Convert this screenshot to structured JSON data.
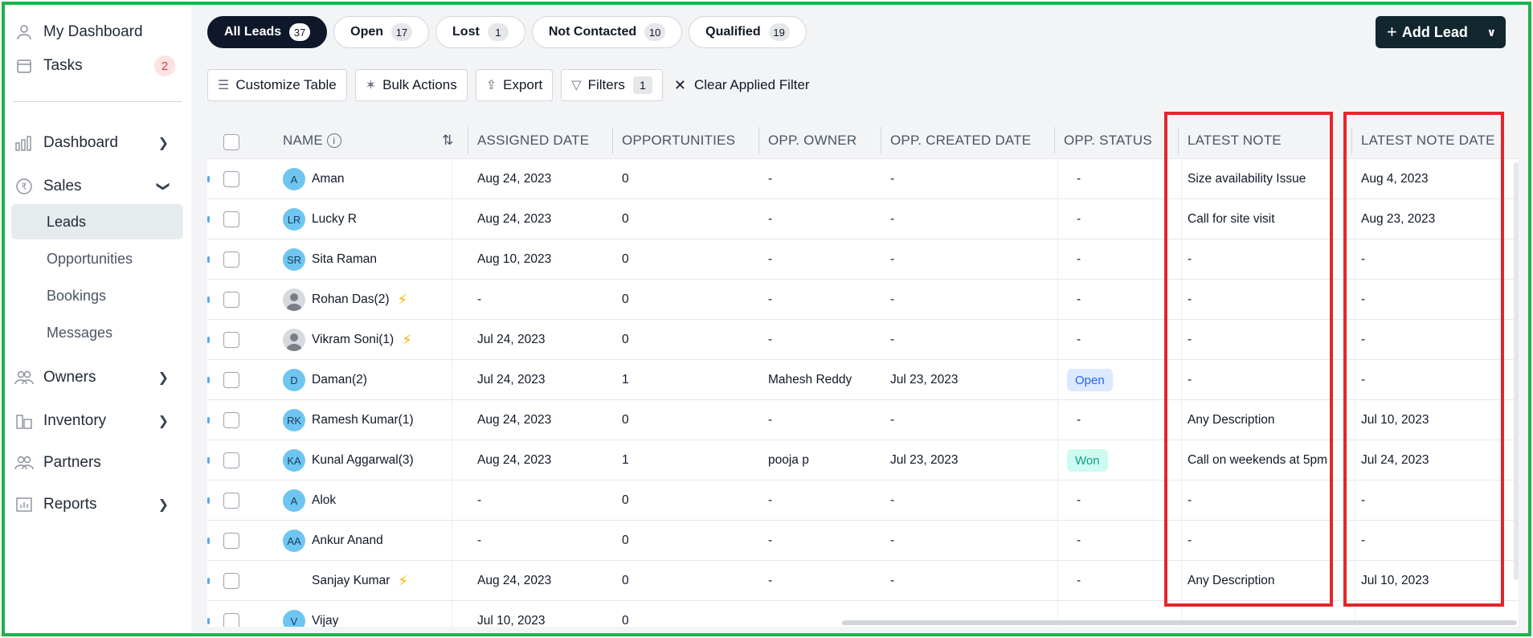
{
  "sidebar": {
    "items": [
      {
        "label": "My Dashboard",
        "icon": "user-icon"
      },
      {
        "label": "Tasks",
        "icon": "calendar-icon",
        "badge": "2"
      },
      {
        "label": "Dashboard",
        "icon": "bar-chart-icon"
      },
      {
        "label": "Sales",
        "icon": "rupee-icon"
      },
      {
        "label": "Owners",
        "icon": "users-icon"
      },
      {
        "label": "Inventory",
        "icon": "building-icon"
      },
      {
        "label": "Partners",
        "icon": "partners-icon"
      },
      {
        "label": "Reports",
        "icon": "report-icon"
      }
    ],
    "sales_sub": [
      "Leads",
      "Opportunities",
      "Bookings",
      "Messages"
    ]
  },
  "tabs": [
    {
      "label": "All Leads",
      "count": "37"
    },
    {
      "label": "Open",
      "count": "17"
    },
    {
      "label": "Lost",
      "count": "1"
    },
    {
      "label": "Not Contacted",
      "count": "10"
    },
    {
      "label": "Qualified",
      "count": "19"
    }
  ],
  "add_lead_label": "Add Lead",
  "toolbar": {
    "customize": "Customize Table",
    "bulk": "Bulk Actions",
    "export": "Export",
    "filters": "Filters",
    "filters_count": "1",
    "clear": "Clear Applied Filter"
  },
  "table": {
    "headers": [
      "NAME",
      "ASSIGNED DATE",
      "OPPORTUNITIES",
      "OPP. OWNER",
      "OPP. CREATED DATE",
      "OPP. STATUS",
      "LATEST NOTE",
      "LATEST NOTE DATE"
    ],
    "rows": [
      {
        "initials": "A",
        "name": "Aman",
        "assigned": "Aug 24, 2023",
        "opps": "0",
        "owner": "-",
        "created": "-",
        "status": "-",
        "note": "Size availability Issue",
        "note_date": "Aug 4, 2023"
      },
      {
        "initials": "LR",
        "name": "Lucky R",
        "assigned": "Aug 24, 2023",
        "opps": "0",
        "owner": "-",
        "created": "-",
        "status": "-",
        "note": "Call for site visit",
        "note_date": "Aug 23, 2023"
      },
      {
        "initials": "SR",
        "name": "Sita Raman",
        "assigned": "Aug 10, 2023",
        "opps": "0",
        "owner": "-",
        "created": "-",
        "status": "-",
        "note": "-",
        "note_date": "-"
      },
      {
        "initials": "",
        "name": "Rohan Das(2)",
        "assigned": "-",
        "opps": "0",
        "owner": "-",
        "created": "-",
        "status": "-",
        "note": "-",
        "note_date": "-"
      },
      {
        "initials": "",
        "name": "Vikram Soni(1)",
        "assigned": "Jul 24, 2023",
        "opps": "0",
        "owner": "-",
        "created": "-",
        "status": "-",
        "note": "-",
        "note_date": "-"
      },
      {
        "initials": "D",
        "name": "Daman(2)",
        "assigned": "Jul 24, 2023",
        "opps": "1",
        "owner": "Mahesh Reddy",
        "created": "Jul 23, 2023",
        "status": "Open",
        "note": "-",
        "note_date": "-"
      },
      {
        "initials": "RK",
        "name": "Ramesh Kumar(1)",
        "assigned": "Aug 24, 2023",
        "opps": "0",
        "owner": "-",
        "created": "-",
        "status": "-",
        "note": "Any Description",
        "note_date": "Jul 10, 2023"
      },
      {
        "initials": "KA",
        "name": "Kunal Aggarwal(3)",
        "assigned": "Aug 24, 2023",
        "opps": "1",
        "owner": "pooja p",
        "created": "Jul 23, 2023",
        "status": "Won",
        "note": "Call on weekends at 5pm",
        "note_date": "Jul 24, 2023"
      },
      {
        "initials": "A",
        "name": "Alok",
        "assigned": "-",
        "opps": "0",
        "owner": "-",
        "created": "-",
        "status": "-",
        "note": "-",
        "note_date": "-"
      },
      {
        "initials": "AA",
        "name": "Ankur Anand",
        "assigned": "-",
        "opps": "0",
        "owner": "-",
        "created": "-",
        "status": "-",
        "note": "-",
        "note_date": "-"
      },
      {
        "initials": "",
        "name": "Sanjay Kumar",
        "assigned": "Aug 24, 2023",
        "opps": "0",
        "owner": "-",
        "created": "-",
        "status": "-",
        "note": "Any Description",
        "note_date": "Jul 10, 2023"
      },
      {
        "initials": "V",
        "name": "Vijay",
        "assigned": "Jul 10, 2023",
        "opps": "0",
        "owner": "",
        "created": "",
        "status": "",
        "note": "",
        "note_date": ""
      }
    ]
  },
  "colors": {
    "accent": "#12262e",
    "highlight": "#e3262b",
    "frame": "#1db34a"
  }
}
